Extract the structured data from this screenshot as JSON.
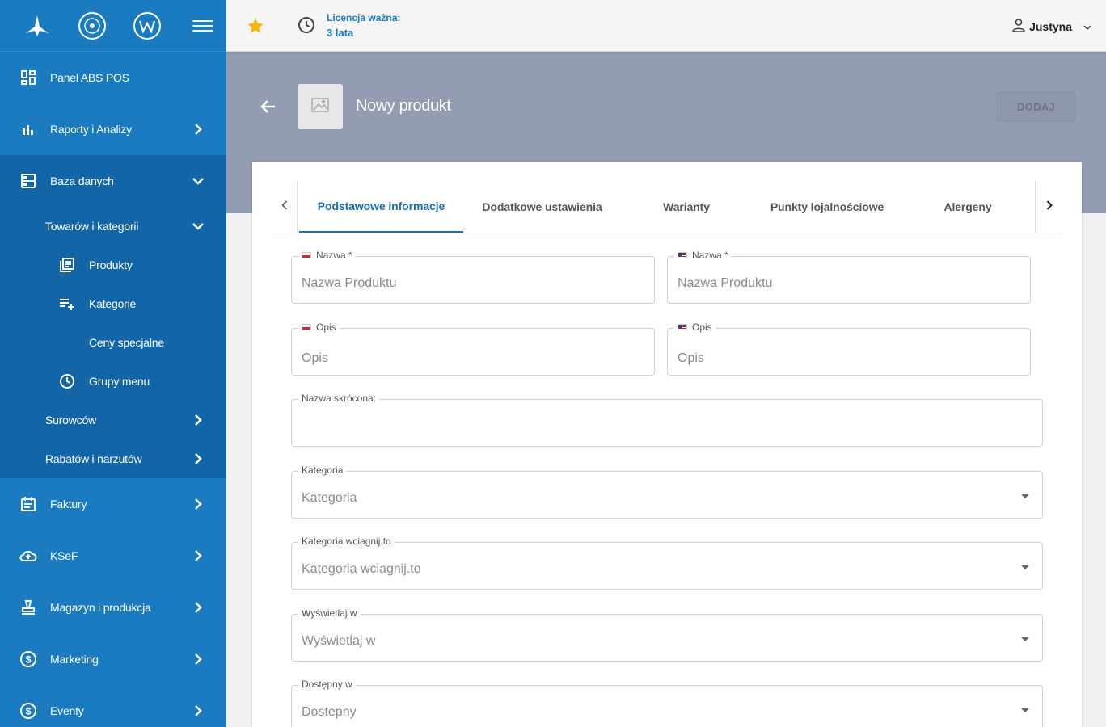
{
  "sidebar": {
    "items": [
      {
        "label": "Panel ABS POS",
        "icon": "dashboard-icon"
      },
      {
        "label": "Raporty i Analizy",
        "icon": "bar-chart-icon"
      },
      {
        "label": "Baza danych",
        "icon": "database-icon"
      },
      {
        "label": "Towarów i kategorii"
      },
      {
        "label": "Produkty",
        "icon": "library-books-icon"
      },
      {
        "label": "Kategorie",
        "icon": "playlist-add-icon"
      },
      {
        "label": "Ceny specjalne"
      },
      {
        "label": "Grupy menu",
        "icon": "clock-icon"
      },
      {
        "label": "Surowców"
      },
      {
        "label": "Rabatów i narzutów"
      },
      {
        "label": "Faktury",
        "icon": "calendar-icon"
      },
      {
        "label": "KSeF",
        "icon": "cloud-upload-icon"
      },
      {
        "label": "Magazyn i produkcja",
        "icon": "stamp-icon"
      },
      {
        "label": "Marketing",
        "icon": "dollar-circle-icon"
      },
      {
        "label": "Eventy",
        "icon": "dollar-circle-icon"
      }
    ]
  },
  "topbar": {
    "license_label": "Licencja ważna:",
    "license_value": "3 lata",
    "user_name": "Justyna"
  },
  "header": {
    "title": "Nowy produkt",
    "add_button": "DODAJ"
  },
  "tabs": [
    {
      "label": "Podstawowe informacje",
      "active": true
    },
    {
      "label": "Dodatkowe ustawienia"
    },
    {
      "label": "Warianty"
    },
    {
      "label": "Punkty lojalnościowe"
    },
    {
      "label": "Alergeny"
    }
  ],
  "form": {
    "name_pl_label": "Nazwa *",
    "name_pl_placeholder": "Nazwa Produktu",
    "name_en_label": "Nazwa *",
    "name_en_placeholder": "Nazwa Produktu",
    "desc_pl_label": "Opis",
    "desc_pl_placeholder": "Opis",
    "desc_en_label": "Opis",
    "desc_en_placeholder": "Opis",
    "short_name_label": "Nazwa skrócona:",
    "category_label": "Kategoria",
    "category_placeholder": "Kategoria",
    "category_wc_label": "Kategoria wciagnij.to",
    "category_wc_placeholder": "Kategoria wciagnij.to",
    "display_in_label": "Wyświetlaj w",
    "display_in_placeholder": "Wyświetlaj w",
    "available_in_label": "Dostępny w",
    "available_in_placeholder": "Dostepny"
  },
  "colors": {
    "sidebar": "#1a7bc1",
    "sidebar_sub": "#1265a6",
    "accent": "#1a6fb0",
    "header_band": "#939cb2",
    "star": "#f5b50a"
  }
}
